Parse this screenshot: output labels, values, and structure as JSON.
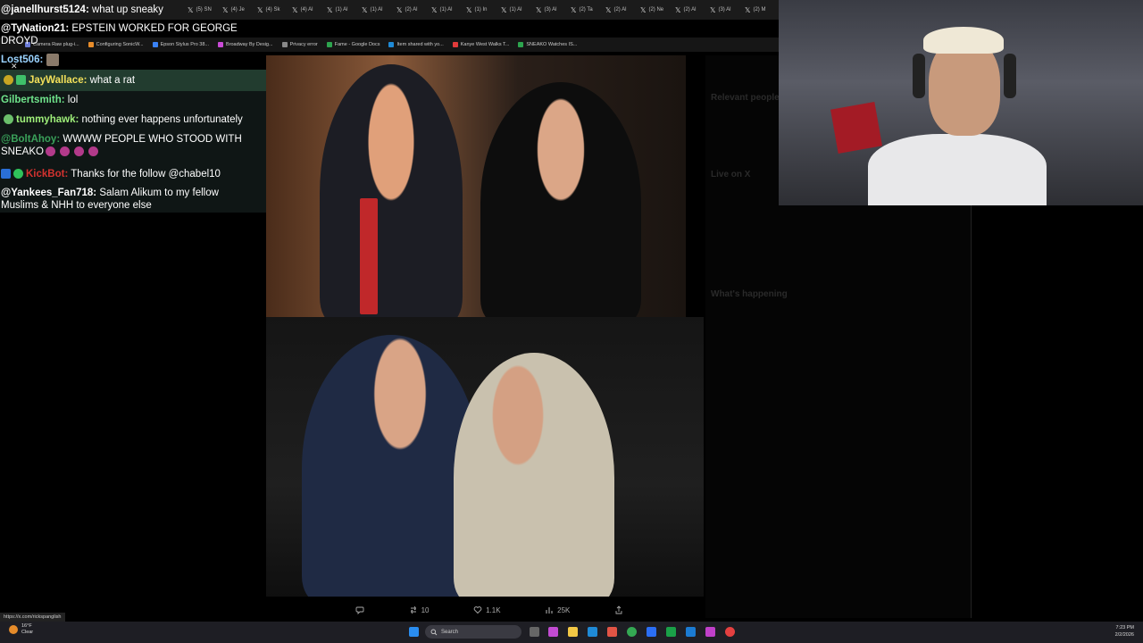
{
  "browser": {
    "tabs": [
      "(5) SN",
      "(4) Je",
      "(4) Sk",
      "(4) Al",
      "(1) Al",
      "(1) Al",
      "(2) Al",
      "(1) Al",
      "(1) In",
      "(1) Al",
      "(3) Al",
      "(2) Ta",
      "(2) Al",
      "(2) Ne",
      "(2) Al",
      "(3) Al",
      "(2) M"
    ],
    "bookmarks": [
      "Camera Raw plug-i...",
      "Configuring SonicW...",
      "Epson Stylus Pro 38...",
      "Broadway By Desig...",
      "Privacy error",
      "Fame - Google Docs",
      "Item shared with yo...",
      "Kanye West Walks T...",
      "SNEAKO Watches IS..."
    ],
    "status_url": "https://x.com/rickspanglish"
  },
  "chat": {
    "messages": [
      {
        "user": "@janellhurst5124:",
        "text": "what up sneaky",
        "color": "#ffffff"
      },
      {
        "user": "@TyNation21:",
        "text": "EPSTEIN WORKED FOR GEORGE",
        "color": "#ffffff"
      },
      {
        "user": "",
        "text": "DROYD",
        "color": "#ffffff"
      },
      {
        "user": "Lost506:",
        "text": "",
        "color": "#9bd3ff"
      },
      {
        "user": "JayWallace:",
        "text": "what a rat",
        "color": "#f3e05a"
      },
      {
        "user": "Gilbertsmith:",
        "text": "lol",
        "color": "#6fe38b"
      },
      {
        "user": "tummyhawk:",
        "text": "nothing ever happens unfortunately",
        "color": "#9ff07a"
      },
      {
        "user": "@BoltAhoy:",
        "text": "WWWW PEOPLE WHO STOOD WITH",
        "color": "#3aa15a"
      },
      {
        "user": "",
        "text": "SNEAKO",
        "color": "#ffffff"
      },
      {
        "user": "KickBot:",
        "text": "Thanks for the follow @chabel10",
        "color": "#d3322f"
      },
      {
        "user": "@Yankees_Fan718:",
        "text": "Salam Alikum to my fellow",
        "color": "#ffffff"
      },
      {
        "user": "",
        "text": "Muslims & NHH to everyone else",
        "color": "#ffffff"
      }
    ]
  },
  "post": {
    "actions": {
      "retweets": "10",
      "likes": "1.1K",
      "views": "25K"
    }
  },
  "right_panel": {
    "rows": [
      "Relevant people",
      "Live on X",
      "What's happening"
    ]
  },
  "taskbar": {
    "weather_temp": "16°F",
    "weather_cond": "Clear",
    "search_placeholder": "Search",
    "time": "7:23 PM",
    "date": "2/2/2026"
  },
  "colors": {
    "accent": "#1d9bf0",
    "taskbar": "#1e1e24"
  },
  "icons": [
    "close-icon",
    "reply-icon",
    "retweet-icon",
    "heart-icon",
    "views-icon",
    "share-icon",
    "windows-icon",
    "search-icon"
  ]
}
